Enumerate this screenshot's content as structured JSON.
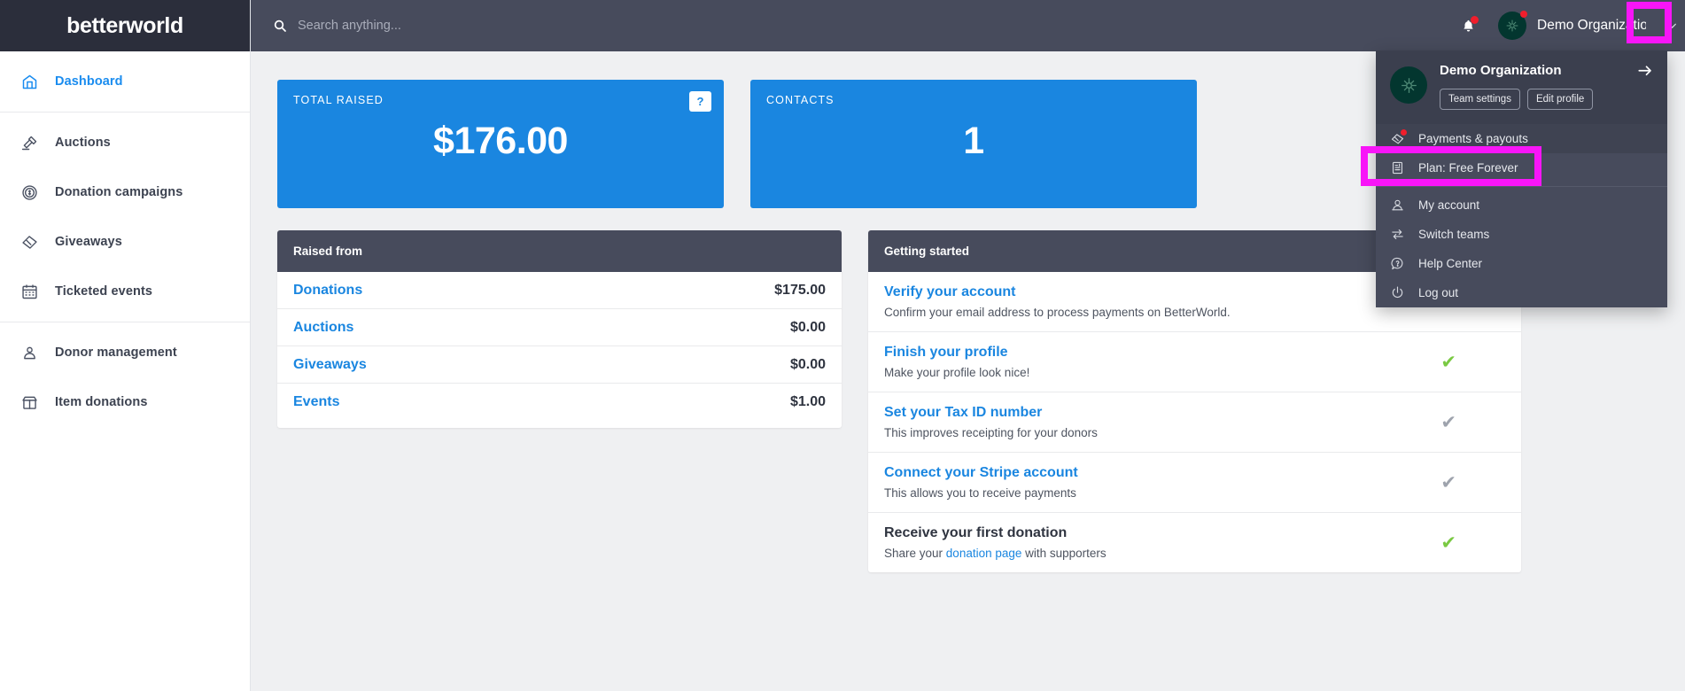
{
  "brand": {
    "name": "betterworld"
  },
  "sidebar": {
    "groups": [
      {
        "items": [
          {
            "label": "Dashboard",
            "icon": "dashboard-icon",
            "active": true
          }
        ]
      },
      {
        "items": [
          {
            "label": "Auctions",
            "icon": "gavel-icon",
            "active": false
          },
          {
            "label": "Donation campaigns",
            "icon": "coin-dollar-icon",
            "active": false
          },
          {
            "label": "Giveaways",
            "icon": "ticket-icon",
            "active": false
          },
          {
            "label": "Ticketed events",
            "icon": "calendar-icon",
            "active": false
          }
        ]
      },
      {
        "items": [
          {
            "label": "Donor management",
            "icon": "people-icon",
            "active": false
          },
          {
            "label": "Item donations",
            "icon": "gift-box-icon",
            "active": false
          }
        ]
      }
    ]
  },
  "topbar": {
    "search_placeholder": "Search anything...",
    "search_value": "",
    "search_icon": "search-icon",
    "bell_icon": "bell-icon",
    "bell_has_notification": true,
    "org_name": "Demo Organizatio",
    "org_avatar_icon": "compass-rose-icon",
    "org_avatar_has_notification": true,
    "chevron_icon": "chevron-down-icon"
  },
  "dropdown": {
    "org_title": "Demo Organization",
    "arrow_icon": "arrow-right-icon",
    "avatar_icon": "compass-rose-icon",
    "buttons": [
      {
        "label": "Team settings"
      },
      {
        "label": "Edit profile"
      }
    ],
    "items": [
      {
        "label": "Payments & payouts",
        "icon": "ticket-payment-icon",
        "badge": true,
        "hovered": true
      },
      {
        "label": "Plan: Free Forever",
        "icon": "invoice-icon",
        "badge": false,
        "hovered": false
      },
      {
        "label": "My account",
        "icon": "user-icon",
        "badge": false,
        "hovered": false
      },
      {
        "label": "Switch teams",
        "icon": "switch-arrows-icon",
        "badge": false,
        "hovered": false
      },
      {
        "label": "Help Center",
        "icon": "question-bubble-icon",
        "badge": false,
        "hovered": false
      },
      {
        "label": "Log out",
        "icon": "power-icon",
        "badge": false,
        "hovered": false
      }
    ]
  },
  "stats": [
    {
      "label": "TOTAL RAISED",
      "value": "$176.00",
      "help_badge": "?",
      "has_help": true
    },
    {
      "label": "CONTACTS",
      "value": "1",
      "has_help": false
    }
  ],
  "raised_from": {
    "title": "Raised from",
    "rows": [
      {
        "name": "Donations",
        "amount": "$175.00"
      },
      {
        "name": "Auctions",
        "amount": "$0.00"
      },
      {
        "name": "Giveaways",
        "amount": "$0.00"
      },
      {
        "name": "Events",
        "amount": "$1.00"
      }
    ]
  },
  "getting_started": {
    "title": "Getting started",
    "rows": [
      {
        "title": "Verify your account",
        "desc": "Confirm your email address to process payments on BetterWorld.",
        "check": "none",
        "done": false
      },
      {
        "title": "Finish your profile",
        "desc": "Make your profile look nice!",
        "check": "green",
        "done": false
      },
      {
        "title": "Set your Tax ID number",
        "desc": "This improves receipting for your donors",
        "check": "grey",
        "done": false
      },
      {
        "title": "Connect your Stripe account",
        "desc": "This allows you to receive payments",
        "check": "grey",
        "done": false
      },
      {
        "title": "Receive your first donation",
        "desc_pre": "Share your ",
        "desc_link": "donation page",
        "desc_post": " with supporters",
        "check": "green",
        "done": true
      }
    ]
  },
  "colors": {
    "brand_dark": "#2b2e3b",
    "topbar": "#474b5c",
    "accent_blue": "#1a86e0",
    "link_blue": "#1a8cef",
    "highlight_magenta": "#f815f8",
    "check_green": "#7ac943",
    "check_grey": "#9ea3ad",
    "avatar_green": "#03362f",
    "badge_red": "#f01e2c"
  }
}
